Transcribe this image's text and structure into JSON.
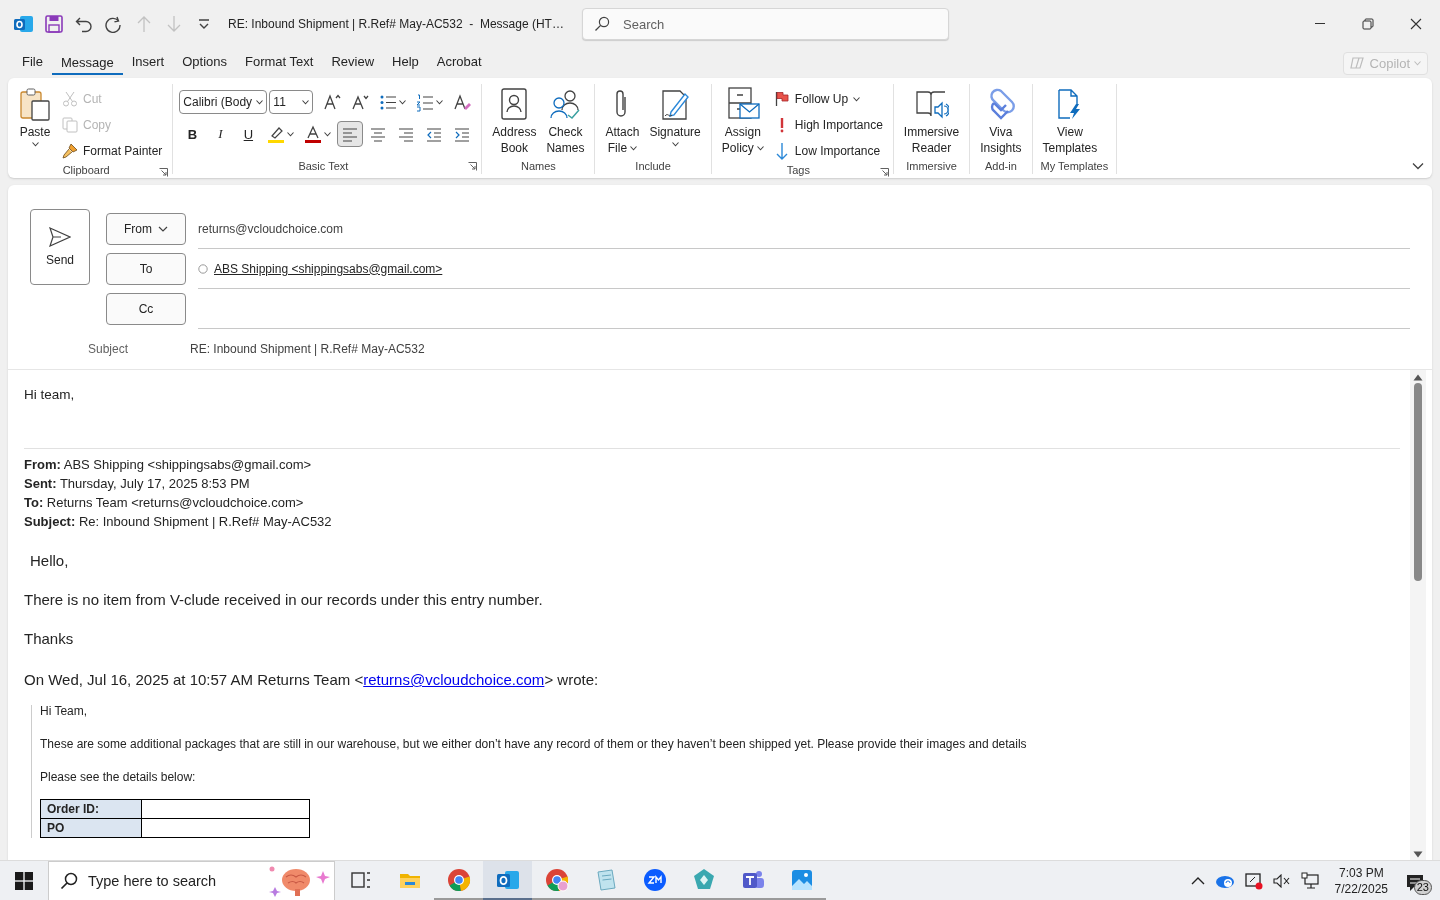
{
  "title_bar": {
    "title": "RE: Inbound Shipment | R.Ref# May-AC532  -  Message (HT…",
    "search": {
      "placeholder": "Search"
    }
  },
  "quick_access": [
    {
      "disabled": false
    },
    {
      "disabled": false
    },
    {
      "disabled": false
    },
    {
      "disabled": true
    },
    {
      "disabled": true
    },
    {
      "disabled": false
    }
  ],
  "menu_tabs": [
    {
      "label": "File",
      "selected": false
    },
    {
      "label": "Message",
      "selected": true
    },
    {
      "label": "Insert",
      "selected": false
    },
    {
      "label": "Options",
      "selected": false
    },
    {
      "label": "Format Text",
      "selected": false
    },
    {
      "label": "Review",
      "selected": false
    },
    {
      "label": "Help",
      "selected": false
    },
    {
      "label": "Acrobat",
      "selected": false
    }
  ],
  "copilot": {
    "label": "Copilot",
    "disabled": true
  },
  "ribbon": {
    "groups": [
      {
        "label": "Clipboard",
        "launcher": true,
        "items": [
          {
            "kind": "large",
            "label": "Paste",
            "dropdown": true,
            "disabled": false
          },
          {
            "kind": "small",
            "label": "Cut",
            "dropdown": false,
            "disabled": true
          },
          {
            "kind": "small",
            "label": "Copy",
            "dropdown": false,
            "disabled": true
          },
          {
            "kind": "small",
            "label": "Format Painter",
            "dropdown": false,
            "disabled": false
          }
        ]
      },
      {
        "label": "Basic Text",
        "launcher": true,
        "toolbars": [
          {
            "tools": [
              {
                "kind": "field",
                "value": "Calibri (Body"
              },
              {
                "kind": "field",
                "value": "11"
              },
              {
                "kind": "tool",
                "dropdown": false,
                "selected": false
              },
              {
                "kind": "tool",
                "dropdown": false,
                "selected": false
              },
              {
                "kind": "tool",
                "dropdown": true,
                "selected": false
              },
              {
                "kind": "tool",
                "dropdown": true,
                "selected": false
              },
              {
                "kind": "tool",
                "dropdown": false,
                "selected": false
              }
            ]
          },
          {
            "tools": [
              {
                "kind": "letter",
                "label": "B",
                "selected": false
              },
              {
                "kind": "letter",
                "label": "I",
                "selected": false
              },
              {
                "kind": "letter",
                "label": "U",
                "selected": false
              },
              {
                "kind": "tool",
                "dropdown": true,
                "selected": false
              },
              {
                "kind": "tool",
                "dropdown": true,
                "selected": false
              },
              {
                "kind": "tool",
                "dropdown": false,
                "selected": true
              },
              {
                "kind": "tool",
                "dropdown": false,
                "selected": false
              },
              {
                "kind": "tool",
                "dropdown": false,
                "selected": false
              },
              {
                "kind": "tool",
                "dropdown": false,
                "selected": false
              },
              {
                "kind": "tool",
                "dropdown": false,
                "selected": false
              }
            ]
          }
        ]
      },
      {
        "label": "Names",
        "items": [
          {
            "kind": "large",
            "label": "Address Book",
            "dropdown": false,
            "disabled": false
          },
          {
            "kind": "large",
            "label": "Check Names",
            "dropdown": false,
            "disabled": false
          }
        ]
      },
      {
        "label": "Include",
        "items": [
          {
            "kind": "large",
            "label": "Attach File",
            "dropdown": true,
            "disabled": false
          },
          {
            "kind": "large",
            "label": "Signature",
            "dropdown": true,
            "disabled": false
          }
        ]
      },
      {
        "label": "Tags",
        "launcher": true,
        "items": [
          {
            "kind": "large",
            "label": "Assign Policy",
            "dropdown": true,
            "disabled": false
          },
          {
            "kind": "small",
            "label": "Follow Up",
            "dropdown": true,
            "disabled": false
          },
          {
            "kind": "small",
            "label": "High Importance",
            "dropdown": false,
            "disabled": false
          },
          {
            "kind": "small",
            "label": "Low Importance",
            "dropdown": false,
            "disabled": false
          }
        ]
      },
      {
        "label": "Immersive",
        "items": [
          {
            "kind": "large",
            "label": "Immersive Reader",
            "dropdown": false,
            "disabled": false
          }
        ]
      },
      {
        "label": "Add-in",
        "items": [
          {
            "kind": "large",
            "label": "Viva Insights",
            "dropdown": false,
            "disabled": false
          }
        ]
      },
      {
        "label": "My Templates",
        "items": [
          {
            "kind": "large",
            "label": "View Templates",
            "dropdown": false,
            "disabled": false
          }
        ]
      }
    ]
  },
  "compose": {
    "send": "Send",
    "fields": [
      {
        "kind": "dropdown",
        "label": "From",
        "value": "returns@vcloudchoice.com"
      },
      {
        "kind": "button",
        "label": "To",
        "recipient": "ABS Shipping <shippingsabs@gmail.com>"
      },
      {
        "kind": "button",
        "label": "Cc"
      }
    ],
    "subject_label": "Subject",
    "subject": "RE: Inbound Shipment | R.Ref# May-AC532"
  },
  "body": {
    "greeting": "Hi team,",
    "quoted_header": [
      "**From:** ABS Shipping <shippingsabs@gmail.com>",
      "**Sent:** Thursday, July 17, 2025 8:53 PM",
      "**To:** Returns Team <returns@vcloudchoice.com>",
      "**Subject:** Re: Inbound Shipment | R.Ref# May-AC532"
    ],
    "paragraphs": [
      "Hello,",
      "There is no item from V-clude received in our records under this entry number.",
      "Thanks"
    ],
    "reply_line": {
      "text": "On Wed, Jul 16, 2025 at 10:57 AM Returns Team <",
      "link": "returns@vcloudchoice.com",
      "after": "> wrote:"
    },
    "quote": {
      "paragraphs": [
        "Hi Team,",
        "These are some additional packages that are still in our warehouse, but we either don’t have any record of them or they haven’t been shipped yet. Please provide their images and details",
        "Please see the details below:"
      ],
      "table": [
        "Order ID:",
        "PO"
      ]
    }
  },
  "taskbar": {
    "search": {
      "placeholder": "Type here to search"
    },
    "apps": [
      {
        "running": false,
        "active": false
      },
      {
        "running": false,
        "active": false
      },
      {
        "running": true,
        "active": false
      },
      {
        "running": true,
        "active": true
      },
      {
        "running": true,
        "active": false
      },
      {
        "running": true,
        "active": false
      },
      {
        "running": true,
        "active": false
      },
      {
        "running": true,
        "active": false
      },
      {
        "running": true,
        "active": false
      },
      {
        "running": true,
        "active": false
      }
    ],
    "time": "7:03 PM",
    "date": "7/22/2025",
    "notifications": "23"
  }
}
